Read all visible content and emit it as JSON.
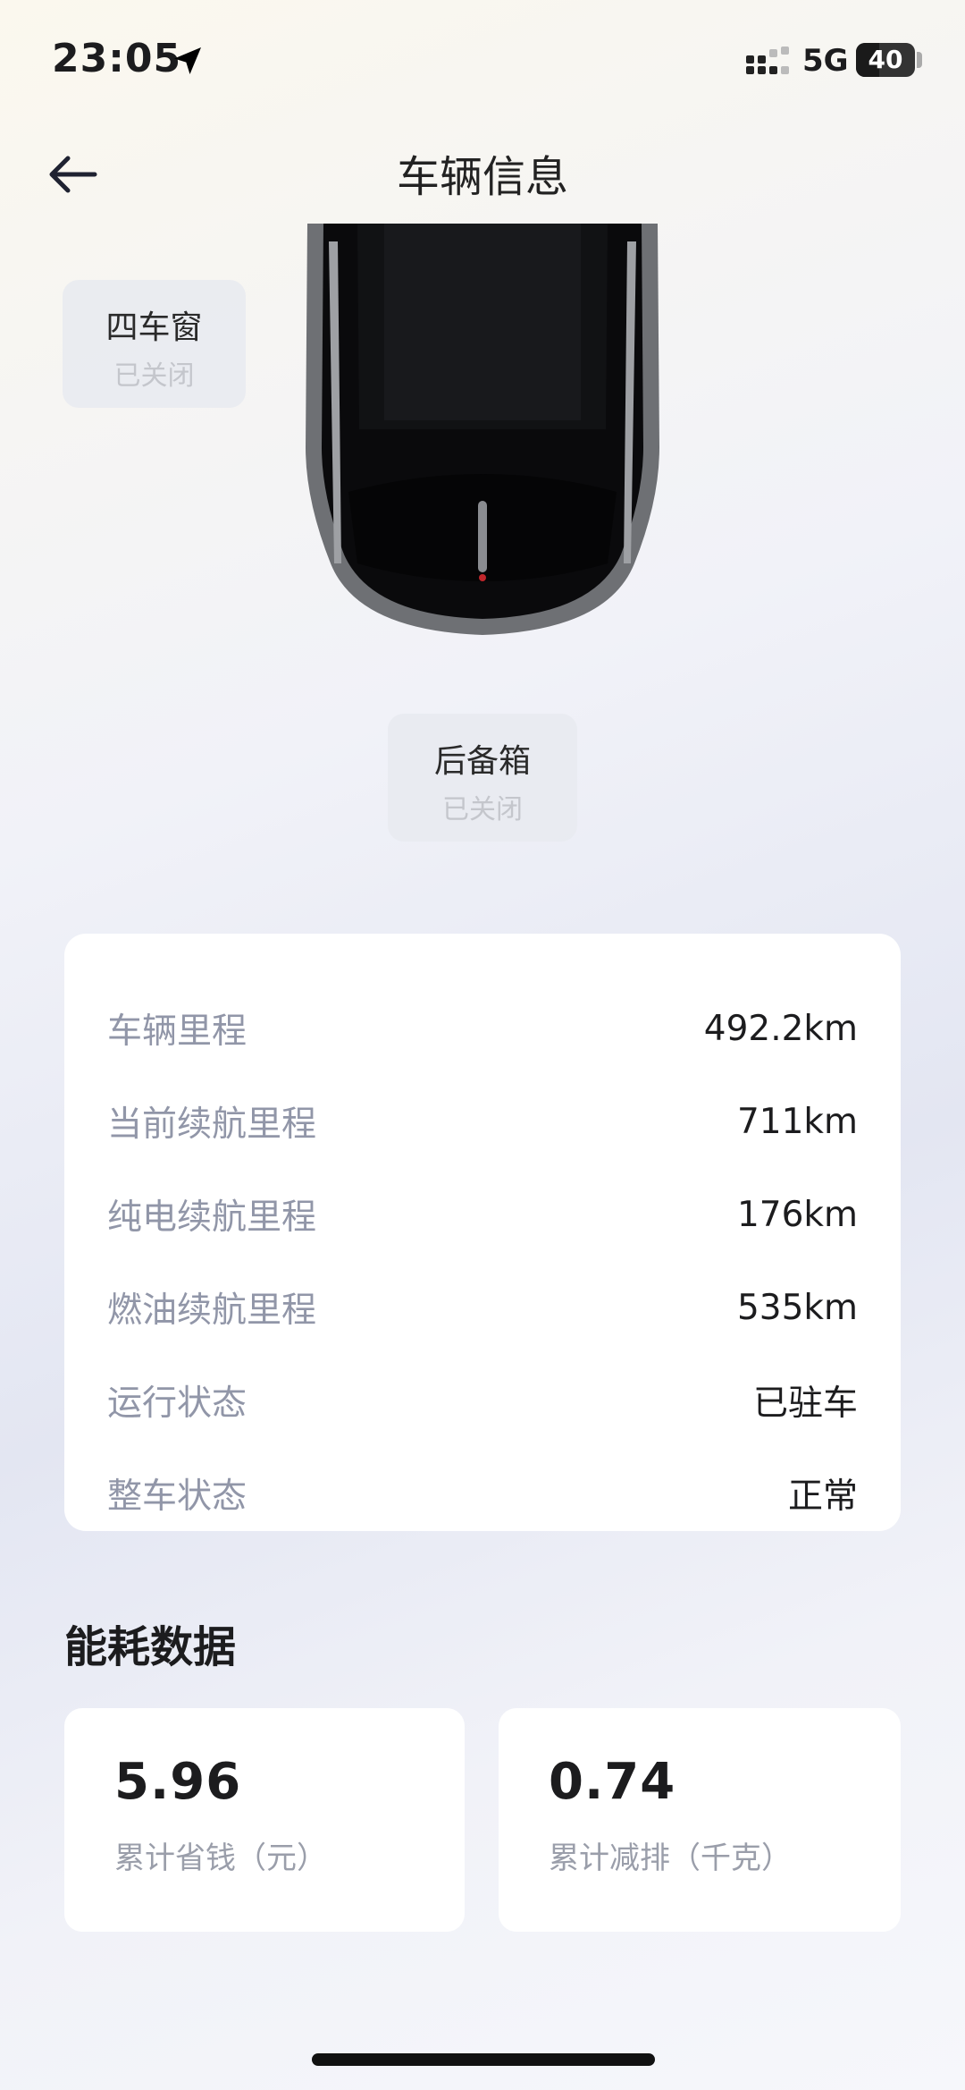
{
  "status_bar": {
    "time": "23:05",
    "network": "5G",
    "battery": "40",
    "battery_level": 0.4
  },
  "header": {
    "title": "车辆信息",
    "back_icon": "back-arrow-icon"
  },
  "vehicle_image": {
    "icon": "car-top-view"
  },
  "chips": {
    "windows": {
      "label": "四车窗",
      "status": "已关闭"
    },
    "trunk": {
      "label": "后备箱",
      "status": "已关闭"
    }
  },
  "info": {
    "rows": [
      {
        "label": "车辆里程",
        "value": "492.2km"
      },
      {
        "label": "当前续航里程",
        "value": "711km"
      },
      {
        "label": "纯电续航里程",
        "value": "176km"
      },
      {
        "label": "燃油续航里程",
        "value": "535km"
      },
      {
        "label": "运行状态",
        "value": "已驻车"
      },
      {
        "label": "整车状态",
        "value": "正常"
      }
    ]
  },
  "energy": {
    "title": "能耗数据",
    "saved": {
      "value": "5.96",
      "caption": "累计省钱（元）"
    },
    "emission": {
      "value": "0.74",
      "caption": "累计减排（千克）"
    }
  }
}
